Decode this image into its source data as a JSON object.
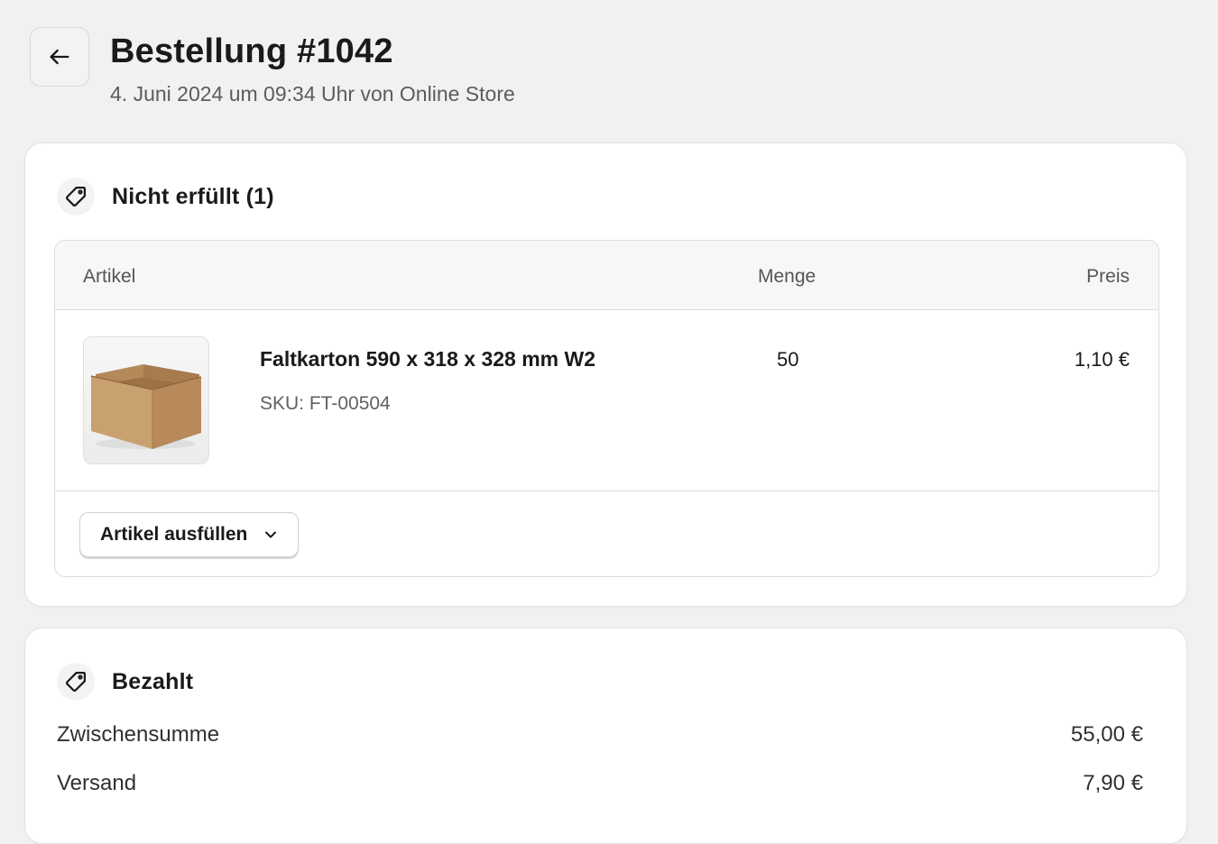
{
  "header": {
    "title": "Bestellung #1042",
    "subtitle": "4. Juni 2024 um 09:34 Uhr von Online Store",
    "back_icon": "arrow-left-icon"
  },
  "unfulfilled": {
    "title": "Nicht erfüllt (1)",
    "icon": "tag-icon",
    "columns": {
      "item": "Artikel",
      "quantity": "Menge",
      "price": "Preis"
    },
    "items": [
      {
        "name": "Faltkarton 590 x 318 x 328 mm W2",
        "sku": "SKU: FT-00504",
        "quantity": "50",
        "price": "1,10 €",
        "image": "cardboard-box-image"
      }
    ],
    "fulfill_button": "Artikel ausfüllen"
  },
  "paid": {
    "title": "Bezahlt",
    "icon": "tag-icon",
    "rows": [
      {
        "label": "Zwischensumme",
        "value": "55,00 €"
      },
      {
        "label": "Versand",
        "value": "7,90 €"
      }
    ]
  },
  "colors": {
    "background": "#f1f1f1",
    "card": "#ffffff",
    "border": "#dcdcdc",
    "text": "#1a1a1a",
    "muted": "#5c5c5c"
  }
}
